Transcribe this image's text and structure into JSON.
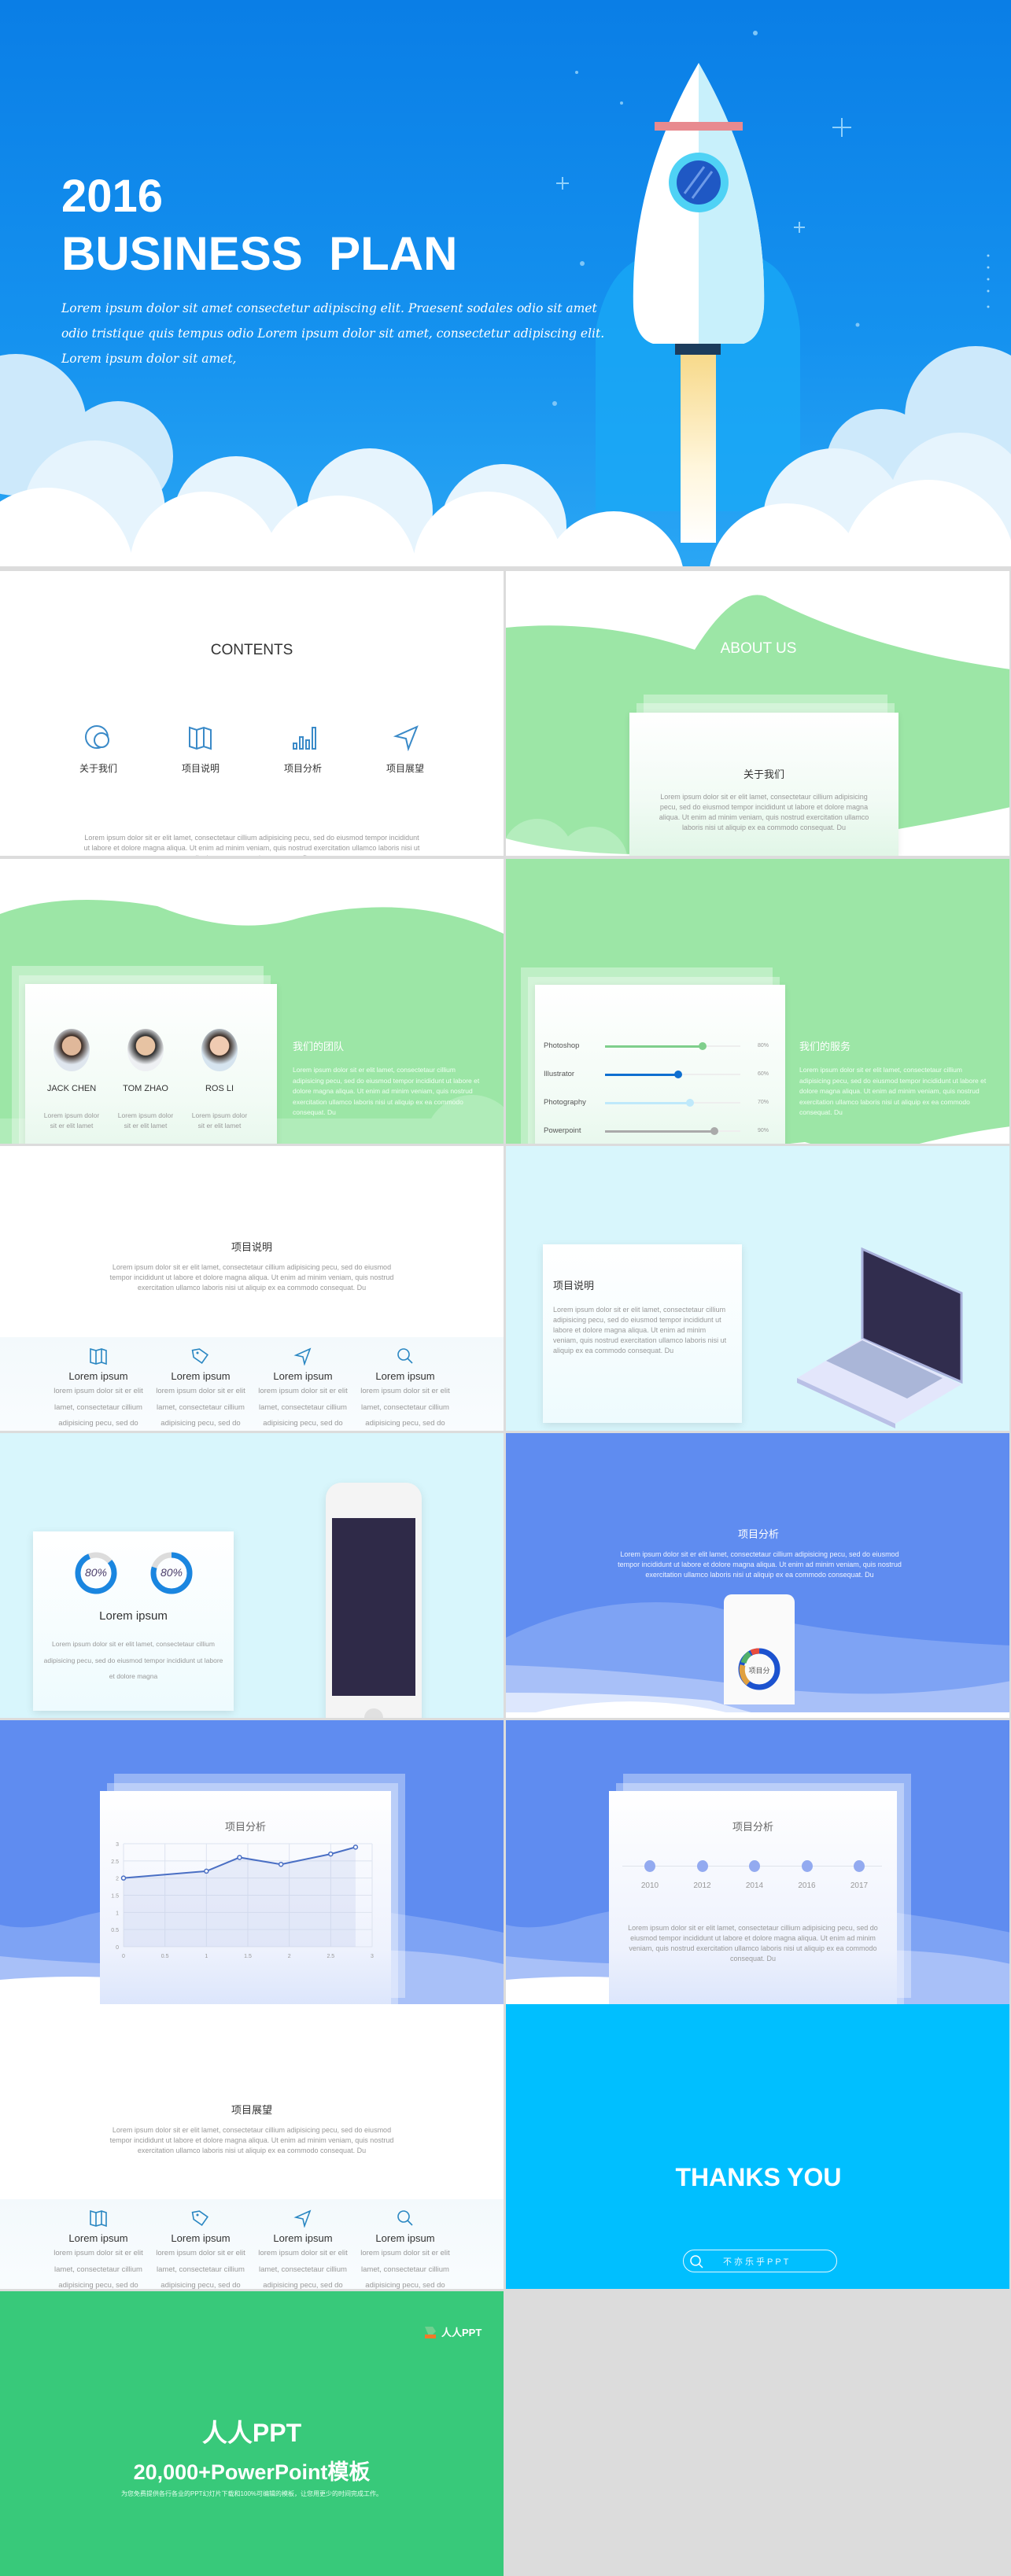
{
  "hero": {
    "year": "2016",
    "title": "BUSINESS  PLAN",
    "desc": "Lorem ipsum dolor sit amet consectetur adipiscing elit. Praesent sodales odio sit amet odio tristique quis tempus odio Lorem ipsum dolor sit amet, consectetur adipiscing elit. Lorem ipsum dolor sit amet,",
    "bg": "#0a7ee6"
  },
  "contents": {
    "title": "CONTENTS",
    "items": [
      {
        "label": "关于我们",
        "icon": "chat-bubbles-icon"
      },
      {
        "label": "项目说明",
        "icon": "map-icon"
      },
      {
        "label": "项目分析",
        "icon": "bar-chart-icon"
      },
      {
        "label": "项目展望",
        "icon": "navigation-arrow-icon"
      }
    ],
    "desc": "Lorem ipsum dolor sit er elit lamet, consectetaur cillium adipisicing pecu, sed do eiusmod tempor incididunt ut labore et dolore magna aliqua. Ut enim ad minim veniam, quis nostrud exercitation ullamco laboris nisi ut aliquip ex ea commodo consequat. Du"
  },
  "about": {
    "title": "ABOUT US",
    "card_title": "关于我们",
    "card_text": "Lorem ipsum dolor sit er elit lamet, consectetaur cillium adipisicing pecu, sed do eiusmod tempor incididunt ut labore et dolore magna aliqua. Ut enim ad minim veniam, quis nostrud exercitation ullamco laboris nisi ut aliquip ex ea commodo consequat. Du",
    "color": "#9ce6a6"
  },
  "team": {
    "title": "我们的团队",
    "text": "Lorem ipsum dolor sit er elit lamet, consectetaur cillium adipisicing pecu, sed do eiusmod tempor incididunt ut labore et dolore magna aliqua. Ut enim ad minim veniam, quis nostrud exercitation ullamco laboris nisi ut aliquip ex ea commodo consequat. Du",
    "members": [
      {
        "name": "JACK CHEN",
        "desc": "Lorem ipsum dolor sit er elit lamet"
      },
      {
        "name": "TOM ZHAO",
        "desc": "Lorem ipsum dolor sit er elit lamet"
      },
      {
        "name": "ROS LI",
        "desc": "Lorem ipsum dolor sit er elit lamet"
      }
    ]
  },
  "services": {
    "title": "我们的服务",
    "text": "Lorem ipsum dolor sit er elit lamet, consectetaur cillium adipisicing pecu, sed do eiusmod tempor incididunt ut labore et dolore magna aliqua. Ut enim ad minim veniam, quis nostrud exercitation ullamco laboris nisi ut aliquip ex ea commodo consequat. Du",
    "skills": [
      {
        "name": "Photoshop",
        "pct": "80%",
        "value": 80,
        "color": "#7fcf8c"
      },
      {
        "name": "Illustrator",
        "pct": "60%",
        "value": 60,
        "color": "#0f6fd0"
      },
      {
        "name": "Photography",
        "pct": "70%",
        "value": 70,
        "color": "#bfe9fb"
      },
      {
        "name": "Powerpoint",
        "pct": "90%",
        "value": 90,
        "color": "#aaaaaa"
      }
    ]
  },
  "project": {
    "title": "项目说明",
    "text": "Lorem ipsum dolor sit er elit lamet, consectetaur cillium adipisicing pecu, sed do eiusmod tempor incididunt ut labore et dolore magna aliqua. Ut enim ad minim veniam, quis nostrud exercitation ullamco laboris nisi ut aliquip ex ea commodo consequat. Du",
    "columns": [
      {
        "icon": "map-icon",
        "title": "Lorem ipsum",
        "text": "lorem ipsum dolor sit er elit lamet, consectetaur cillium adipisicing pecu, sed do eiusmod tempor incididunt ut"
      },
      {
        "icon": "tag-icon",
        "title": "Lorem ipsum",
        "text": "lorem ipsum dolor sit er elit lamet, consectetaur cillium adipisicing pecu, sed do eiusmod tempor incididunt ut"
      },
      {
        "icon": "navigation-arrow-icon",
        "title": "Lorem ipsum",
        "text": "lorem ipsum dolor sit er elit lamet, consectetaur cillium adipisicing pecu, sed do eiusmod tempor incididunt ut"
      },
      {
        "icon": "search-icon",
        "title": "Lorem ipsum",
        "text": "lorem ipsum dolor sit er elit lamet, consectetaur cillium adipisicing pecu, sed do eiusmod tempor incididunt ut"
      }
    ]
  },
  "laptop": {
    "title": "项目说明",
    "text": "Lorem ipsum dolor sit er elit lamet, consectetaur cillium adipisicing pecu, sed do eiusmod tempor incididunt ut labore et dolore magna aliqua. Ut enim ad minim veniam, quis nostrud exercitation ullamco laboris nisi ut aliquip ex ea commodo consequat. Du"
  },
  "donuts": {
    "items": [
      {
        "label": "80%",
        "value": 80
      },
      {
        "label": "80%",
        "value": 80
      }
    ],
    "title": "Lorem ipsum",
    "text": "Lorem ipsum dolor sit er elit lamet, consectetaur cillium adipisicing pecu, sed do eiusmod tempor incididunt ut labore et dolore magna"
  },
  "analysis": {
    "title": "项目分析",
    "text": "Lorem ipsum dolor sit er elit lamet, consectetaur cillium adipisicing pecu, sed do eiusmod tempor incididunt ut labore et dolore magna aliqua. Ut enim ad minim veniam, quis nostrud exercitation ullamco laboris nisi ut aliquip ex ea commodo consequat. Du",
    "phone_label": "项目分",
    "color": "#5f8cf0"
  },
  "chart_slide": {
    "title": "项目分析"
  },
  "chart_data": {
    "type": "line",
    "title": "项目分析",
    "x": [
      0,
      1,
      1.4,
      1.9,
      2.5,
      2.8
    ],
    "y": [
      2,
      2.2,
      2.6,
      2.4,
      2.7,
      2.9
    ],
    "xlim": [
      0,
      3
    ],
    "ylim": [
      0,
      3
    ],
    "xticks": [
      "0",
      "0.5",
      "1",
      "1.5",
      "2",
      "2.5",
      "3"
    ],
    "yticks": [
      "0",
      "0.5",
      "1",
      "1.5",
      "2",
      "2.5",
      "3"
    ],
    "grid": true,
    "color": "#4a6fc4"
  },
  "timeline": {
    "title": "项目分析",
    "years": [
      "2010",
      "2012",
      "2014",
      "2016",
      "2017"
    ],
    "text": "Lorem ipsum dolor sit er elit lamet, consectetaur cillium adipisicing pecu, sed do eiusmod tempor incididunt ut labore et dolore magna aliqua. Ut enim ad minim veniam, quis nostrud exercitation ullamco laboris nisi ut aliquip ex ea commodo consequat. Du"
  },
  "outlook": {
    "title": "项目展望",
    "text": "Lorem ipsum dolor sit er elit lamet, consectetaur cillium adipisicing pecu, sed do eiusmod tempor incididunt ut labore et dolore magna aliqua. Ut enim ad minim veniam, quis nostrud exercitation ullamco laboris nisi ut aliquip ex ea commodo consequat. Du"
  },
  "thanks": {
    "title": "THANKS YOU",
    "search_text": "不亦乐乎PPT",
    "color": "#00bfff"
  },
  "promo": {
    "logo": "人人PPT",
    "title": "人人PPT",
    "subtitle": "20,000+PowerPoint模板",
    "text": "为您免费提供各行各业的PPT幻灯片下载和100%可编辑的模板，让您用更少的时间完成工作。",
    "color": "#38c97a"
  }
}
